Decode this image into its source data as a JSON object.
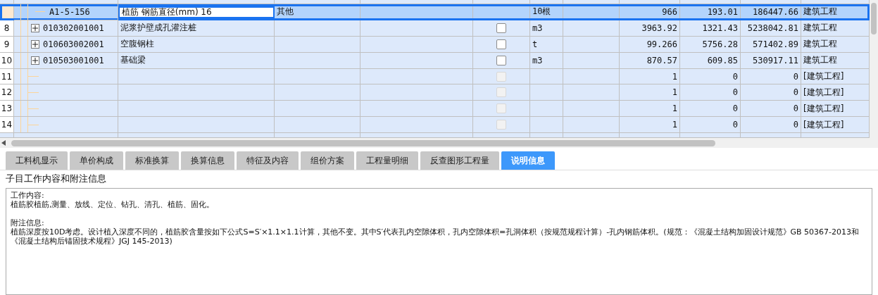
{
  "table": {
    "rows": [
      {
        "row_number": "",
        "kind": "quota",
        "selected": true,
        "code": "A1-5-156",
        "name": "植筋 钢筋直径(mm) 16",
        "column_3": "其他",
        "unit": "10根",
        "quantity": "966",
        "unit_price": "193.01",
        "total": "186447.66",
        "category": "建筑工程"
      },
      {
        "row_number": "8",
        "kind": "bill",
        "selected": false,
        "code": "010302001001",
        "name": "泥浆护壁成孔灌注桩",
        "checkbox": {
          "checked": false,
          "disabled": false
        },
        "unit": "m3",
        "quantity": "3963.92",
        "unit_price": "1321.43",
        "total": "5238042.81",
        "category": "建筑工程"
      },
      {
        "row_number": "9",
        "kind": "bill",
        "selected": false,
        "code": "010603002001",
        "name": "空腹钢柱",
        "checkbox": {
          "checked": false,
          "disabled": false
        },
        "unit": "t",
        "quantity": "99.266",
        "unit_price": "5756.28",
        "total": "571402.89",
        "category": "建筑工程"
      },
      {
        "row_number": "10",
        "kind": "bill",
        "selected": false,
        "code": "010503001001",
        "name": "基础梁",
        "checkbox": {
          "checked": false,
          "disabled": false
        },
        "unit": "m3",
        "quantity": "870.57",
        "unit_price": "609.85",
        "total": "530917.11",
        "category": "建筑工程"
      },
      {
        "row_number": "11",
        "kind": "empty",
        "selected": false,
        "checkbox": {
          "checked": false,
          "disabled": true
        },
        "quantity": "1",
        "unit_price": "0",
        "total": "0",
        "category": "[建筑工程]"
      },
      {
        "row_number": "12",
        "kind": "empty",
        "selected": false,
        "checkbox": {
          "checked": false,
          "disabled": true
        },
        "quantity": "1",
        "unit_price": "0",
        "total": "0",
        "category": "[建筑工程]"
      },
      {
        "row_number": "13",
        "kind": "empty",
        "selected": false,
        "checkbox": {
          "checked": false,
          "disabled": true
        },
        "quantity": "1",
        "unit_price": "0",
        "total": "0",
        "category": "[建筑工程]"
      },
      {
        "row_number": "14",
        "kind": "empty",
        "selected": false,
        "checkbox": {
          "checked": false,
          "disabled": true
        },
        "quantity": "1",
        "unit_price": "0",
        "total": "0",
        "category": "[建筑工程]"
      }
    ]
  },
  "tabs": [
    {
      "label": "工料机显示",
      "selected": false
    },
    {
      "label": "单价构成",
      "selected": false
    },
    {
      "label": "标准换算",
      "selected": false
    },
    {
      "label": "换算信息",
      "selected": false
    },
    {
      "label": "特征及内容",
      "selected": false
    },
    {
      "label": "组价方案",
      "selected": false
    },
    {
      "label": "工程量明细",
      "selected": false
    },
    {
      "label": "反查图形工程量",
      "selected": false
    },
    {
      "label": "说明信息",
      "selected": true
    }
  ],
  "info": {
    "title": "子目工作内容和附注信息",
    "paragraphs": [
      {
        "heading": "工作内容:",
        "text": "植筋胶植筋,测量、放线、定位、钻孔、清孔、植筋、固化。"
      },
      {
        "heading": "附注信息:",
        "text": "植筋深度按10D考虑。设计植入深度不同的，植筋胶含量按如下公式S=S′×1.1×1.1计算，其他不变。其中S′代表孔内空隙体积，孔内空隙体积=孔洞体积（按规范规程计算）-孔内钢筋体积。(规范：《混凝土结构加固设计规范》GB 50367-2013和《混凝土结构后锚固技术规程》JGJ 145-2013)"
      }
    ]
  }
}
